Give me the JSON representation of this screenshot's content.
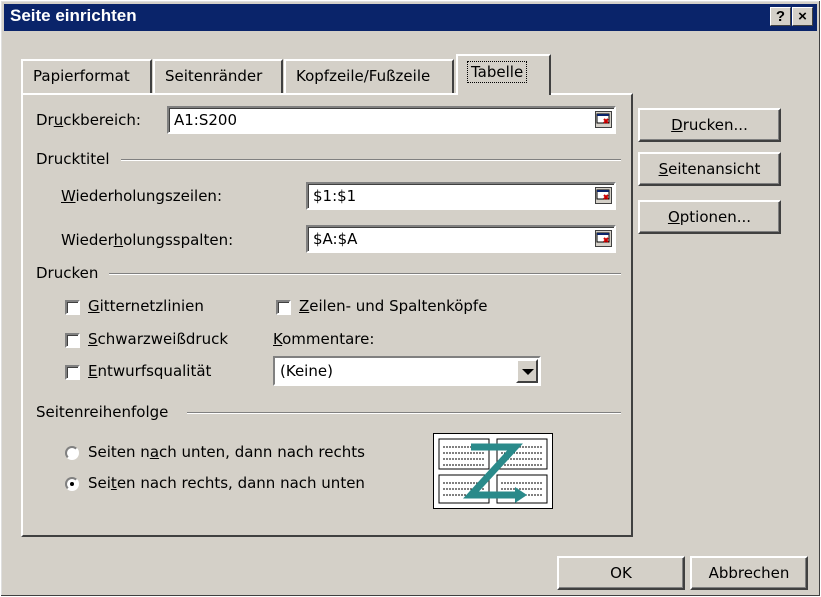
{
  "window": {
    "title": "Seite einrichten",
    "help_button": "?",
    "close_button": "×"
  },
  "tabs": [
    {
      "label": "Papierformat"
    },
    {
      "label": "Seitenränder"
    },
    {
      "label": "Kopfzeile/Fußzeile"
    },
    {
      "label": "Tabelle"
    }
  ],
  "print_area": {
    "label_pre": "Dr",
    "label_acc": "u",
    "label_post": "ckbereich:",
    "value": "A1:S200"
  },
  "print_titles": {
    "group_label": "Drucktitel",
    "rows": {
      "label_acc": "W",
      "label_post": "iederholungszeilen:",
      "value": "$1:$1"
    },
    "cols": {
      "label_pre": "Wieder",
      "label_acc": "h",
      "label_post": "olungsspalten:",
      "value": "$A:$A"
    }
  },
  "print": {
    "group_label": "Drucken",
    "gridlines": {
      "acc": "G",
      "rest": "itternetzlinien",
      "checked": false
    },
    "bw": {
      "acc": "S",
      "rest": "chwarzweißdruck",
      "checked": false
    },
    "draft": {
      "acc": "E",
      "rest": "ntwurfsqualität",
      "checked": false
    },
    "headings": {
      "acc": "Z",
      "rest": "eilen- und Spaltenköpfe",
      "checked": false
    },
    "comments_label_acc": "K",
    "comments_label_rest": "ommentare:",
    "comments_value": "(Keine)"
  },
  "page_order": {
    "group_label": "Seitenreihenfolge",
    "down_then_over": {
      "pre": "Seiten n",
      "acc": "a",
      "post": "ch unten, dann nach rechts",
      "selected": false
    },
    "over_then_down": {
      "pre": "Sei",
      "acc": "t",
      "post": "en nach rechts, dann nach unten",
      "selected": true
    }
  },
  "side_buttons": {
    "print": {
      "acc": "D",
      "rest": "rucken..."
    },
    "preview": {
      "acc": "S",
      "rest": "eitenansicht"
    },
    "options": {
      "acc": "O",
      "rest": "ptionen..."
    }
  },
  "footer": {
    "ok": "OK",
    "cancel": "Abbrechen"
  },
  "colors": {
    "titlebar": "#0a246a",
    "face": "#d4d0c8",
    "order_arrow": "#2a8a8a"
  }
}
